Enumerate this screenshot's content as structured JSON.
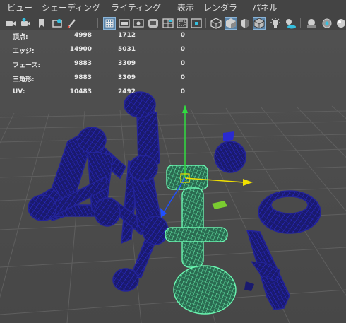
{
  "menu": [
    {
      "label": "ビュー"
    },
    {
      "label": "シェーディング"
    },
    {
      "label": "ライティング"
    },
    {
      "label": "表示"
    },
    {
      "label": "レンダラ"
    },
    {
      "label": "パネル"
    }
  ],
  "toolbar": {
    "icons": [
      "camera-icon",
      "camera-attributes-icon",
      "bookmark-icon",
      "image-plane-icon",
      "pencil-icon",
      "grid-icon",
      "film-gate-icon",
      "resolution-gate-icon",
      "gate-mask-icon",
      "field-chart-icon",
      "safe-action-icon",
      "safe-title-icon",
      "wireframe-icon",
      "smooth-shade-icon",
      "flat-shade-icon",
      "wireframe-on-shaded-icon",
      "default-lighting-icon",
      "shadows-icon",
      "isolate-select-icon",
      "xray-icon"
    ],
    "active": [
      "grid-icon",
      "smooth-shade-icon",
      "wireframe-on-shaded-icon"
    ]
  },
  "hud": {
    "rows": [
      {
        "label": "頂点:",
        "total": "4998",
        "selected": "1712",
        "component": "0"
      },
      {
        "label": "エッジ:",
        "total": "14900",
        "selected": "5031",
        "component": "0"
      },
      {
        "label": "フェース:",
        "total": "9883",
        "selected": "3309",
        "component": "0"
      },
      {
        "label": "三角形:",
        "total": "9883",
        "selected": "3309",
        "component": "0"
      },
      {
        "label": "UV:",
        "total": "10483",
        "selected": "2492",
        "component": "0"
      }
    ]
  },
  "colors": {
    "background": "#444444",
    "menu_text": "#dcdcdc",
    "grid_line": "#5f5f5f",
    "wire_unselected": "#1c1c9a",
    "wire_selected": "#5cf0a8",
    "axis_x": "#f0e000",
    "axis_y": "#30dd40",
    "axis_z": "#2050ff",
    "toolbar_active": "#5b84a8"
  }
}
